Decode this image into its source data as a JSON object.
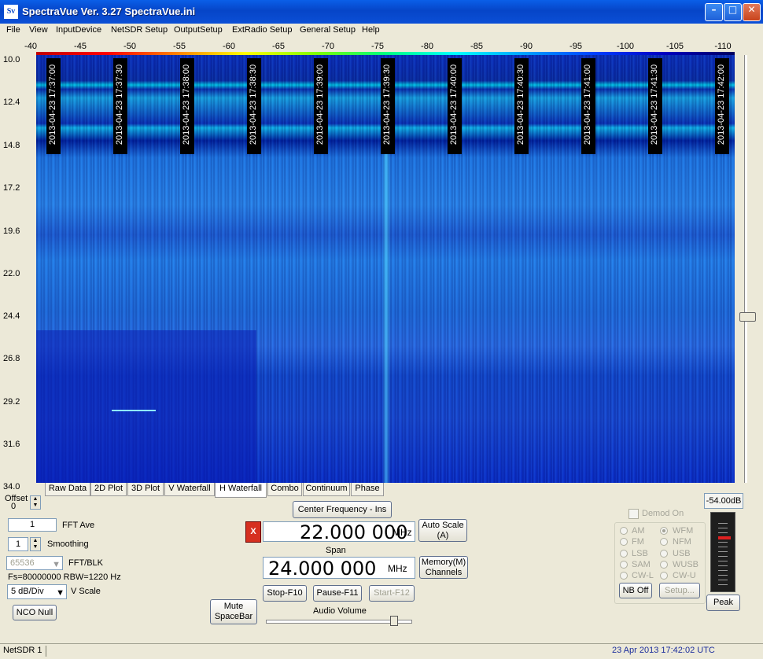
{
  "window": {
    "title": "SpectraVue Ver. 3.27  SpectraVue.ini",
    "icon_text": "Sv"
  },
  "menu": [
    "File",
    "View",
    "InputDevice",
    "NetSDR Setup",
    "OutputSetup",
    "ExtRadio Setup",
    "General Setup",
    "Help"
  ],
  "freq_axis": [
    "-40",
    "-45",
    "-50",
    "-55",
    "-60",
    "-65",
    "-70",
    "-75",
    "-80",
    "-85",
    "-90",
    "-95",
    "-100",
    "-105",
    "-110"
  ],
  "time_axis": [
    "10.0",
    "12.4",
    "14.8",
    "17.2",
    "19.6",
    "22.0",
    "24.4",
    "26.8",
    "29.2",
    "31.6",
    "34.0"
  ],
  "timestamps": [
    "2013-04-23 17:37:00",
    "2013-04-23 17:37:30",
    "2013-04-23 17:38:00",
    "2013-04-23 17:38:30",
    "2013-04-23 17:39:00",
    "2013-04-23 17:39:30",
    "2013-04-23 17:40:00",
    "2013-04-23 17:40:30",
    "2013-04-23 17:41:00",
    "2013-04-23 17:41:30",
    "2013-04-23 17:42:00"
  ],
  "tabs": [
    "Raw Data",
    "2D Plot",
    "3D Plot",
    "V Waterfall",
    "H Waterfall",
    "Combo",
    "Continuum",
    "Phase"
  ],
  "active_tab": "H Waterfall",
  "left_panel": {
    "offset_label": "Offset",
    "offset_value": "0",
    "fft_ave_value": "1",
    "fft_ave_label": "FFT Ave",
    "smoothing_value": "1",
    "smoothing_label": "Smoothing",
    "fft_blk_value": "65536",
    "fft_blk_label": "FFT/BLK",
    "fs_text": "Fs=80000000 RBW=1220 Hz",
    "vscale_value": "5 dB/Div",
    "vscale_label": "V Scale",
    "nco_null": "NCO Null"
  },
  "center": {
    "center_freq_button": "Center Frequency - Ins",
    "center_freq_value": "22.000 000",
    "center_freq_unit": "MHz",
    "x_button": "X",
    "auto_scale": "Auto Scale\n(A)",
    "span_label": "Span",
    "span_value": "24.000 000",
    "span_unit": "MHz",
    "memory_channels": "Memory(M)\nChannels",
    "stop": "Stop-F10",
    "pause": "Pause-F11",
    "start": "Start-F12",
    "mute": "Mute\nSpaceBar",
    "audio_volume": "Audio Volume",
    "audio_volume_level": 0.9
  },
  "demod": {
    "demod_on": "Demod On",
    "modes_left": [
      "AM",
      "FM",
      "LSB",
      "SAM",
      "CW-L"
    ],
    "modes_right": [
      "WFM",
      "NFM",
      "USB",
      "WUSB",
      "CW-U"
    ],
    "selected": "WFM",
    "nb_off": "NB Off",
    "setup": "Setup..."
  },
  "meter": {
    "level_readout": "-54.00dB",
    "peak_button": "Peak"
  },
  "status": {
    "device": "NetSDR 1",
    "datetime": "23 Apr 2013  17:42:02 UTC"
  }
}
